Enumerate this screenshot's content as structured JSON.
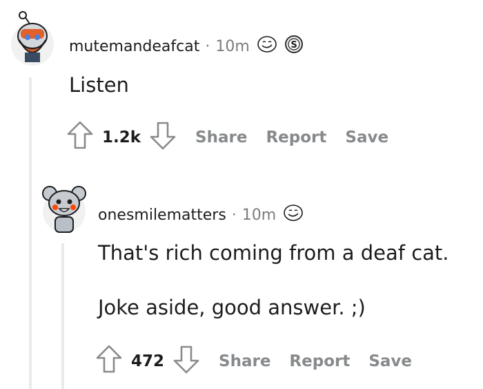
{
  "comments": [
    {
      "username": "mutemandeafcat",
      "separator": "·",
      "time": "10m",
      "awards": [
        "smiley-award-icon",
        "silver-coin-award-icon"
      ],
      "award_coin_letter": "S",
      "body": [
        "Listen"
      ],
      "votes": "1.2k",
      "actions": {
        "share": "Share",
        "report": "Report",
        "save": "Save"
      }
    },
    {
      "username": "onesmilematters",
      "separator": "·",
      "time": "10m",
      "awards": [
        "smiley-award-icon"
      ],
      "body": [
        "That's rich coming from a deaf cat.",
        "Joke aside, good answer. ;)"
      ],
      "votes": "472",
      "actions": {
        "share": "Share",
        "report": "Report",
        "save": "Save"
      }
    }
  ],
  "colors": {
    "action_gray": "#878a8c",
    "thread_line": "#e9eaeb",
    "text": "#1c1c1c"
  }
}
